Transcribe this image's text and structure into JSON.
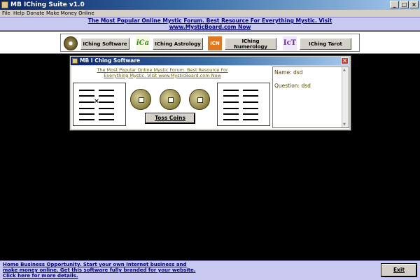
{
  "window": {
    "title": "MB IChing Suite v1.0"
  },
  "menu": [
    "File",
    "Help",
    "Donate",
    "Make Money Online"
  ],
  "banner": {
    "line1": "The Most Popular Online Mystic Forum. Best Resource For Everything Mystic. Visit",
    "line2": "www.MysticBoard.com Now"
  },
  "toolbar": {
    "buttons": [
      "IChing Software",
      "IChing Astrology",
      "IChing Numerology",
      "IChing Tarot"
    ],
    "icons": [
      "iching-coin-icon",
      "ica-logo-icon",
      "icn-logo-icon",
      "ict-logo-icon"
    ],
    "icon_texts": [
      "iCa",
      "ICN",
      "IcT"
    ]
  },
  "dialog": {
    "title": "MB I Ching Software",
    "link_line1": "The Most Popular Online Mystic Forum. Best Resource For",
    "link_line2": "Everything Mystic. Visit www.MysticBoard.com Now",
    "hexagram_left": [
      "broken",
      "broken",
      "changing",
      "broken",
      "broken",
      "broken"
    ],
    "hexagram_right": [
      "broken",
      "broken",
      "broken",
      "broken",
      "broken",
      "broken"
    ],
    "changing_mark": "×",
    "toss_label": "Toss Coins",
    "name_label": "Name:",
    "name_value": "dsd",
    "question_label": "Question:",
    "question_value": "dsd"
  },
  "footer": {
    "promo_line1": "Home Business Opportunity. Start your own Internet business and",
    "promo_line2": "make money online. Get this software fully branded for your website.",
    "promo_line3": "Click here for more details.",
    "exit_label": "Exit"
  },
  "colors": {
    "accent": "#0a246a",
    "banner_bg": "#c8c8f0",
    "link": "#000080",
    "chrome": "#d4d0c8"
  }
}
